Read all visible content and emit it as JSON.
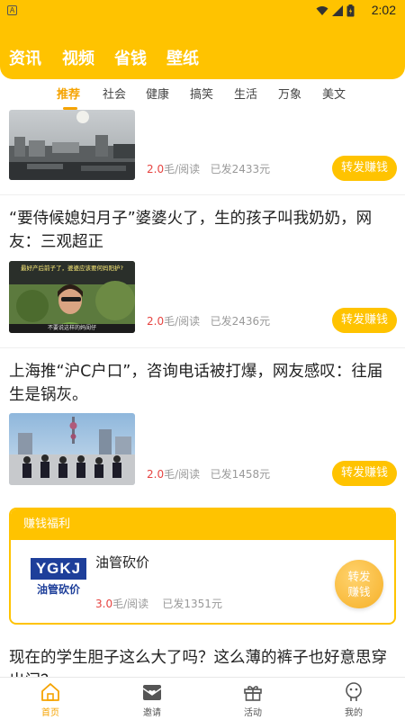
{
  "status_bar": {
    "time": "2:02",
    "indicator": "A"
  },
  "top_tabs": [
    "资讯",
    "视频",
    "省钱",
    "壁纸"
  ],
  "category_tabs": {
    "active": "推荐",
    "items": [
      "推荐",
      "社会",
      "健康",
      "搞笑",
      "生活",
      "万象",
      "美文"
    ]
  },
  "feed": [
    {
      "title": "",
      "price": "2.0",
      "price_unit": "毛/阅读",
      "sent": "已发2433元",
      "share_label": "转发赚钱"
    },
    {
      "title": "“要侍候媳妇月子”婆婆火了，生的孩子叫我奶奶，网友：三观超正",
      "price": "2.0",
      "price_unit": "毛/阅读",
      "sent": "已发2436元",
      "share_label": "转发赚钱",
      "thumb_caption_top": "最好产后前子了，婆婆应该要何妈阳护?",
      "thumb_caption_bottom": "不要说这样的妈闺仔"
    },
    {
      "title": "上海推“沪C户口”，咨询电话被打爆，网友感叹：往届生是锅灰。",
      "price": "2.0",
      "price_unit": "毛/阅读",
      "sent": "已发1458元",
      "share_label": "转发赚钱"
    }
  ],
  "welfare": {
    "header": "赚钱福利",
    "logo_text": "YGKJ",
    "logo_sub": "油管砍价",
    "title": "油管砍价",
    "price": "3.0",
    "price_unit": "毛/阅读",
    "sent": "已发1351元",
    "button_line1": "转发",
    "button_line2": "赚钱"
  },
  "next_article": {
    "title": "现在的学生胆子这么大了吗？这么薄的裤子也好意思穿出门？"
  },
  "bottom_nav": [
    {
      "label": "首页",
      "icon": "home-icon",
      "active": true
    },
    {
      "label": "邀请",
      "icon": "invite-icon",
      "active": false
    },
    {
      "label": "活动",
      "icon": "gift-icon",
      "active": false
    },
    {
      "label": "我的",
      "icon": "profile-icon",
      "active": false
    }
  ],
  "colors": {
    "accent": "#ffc300",
    "active_text": "#f5a300",
    "price": "#e64340"
  }
}
